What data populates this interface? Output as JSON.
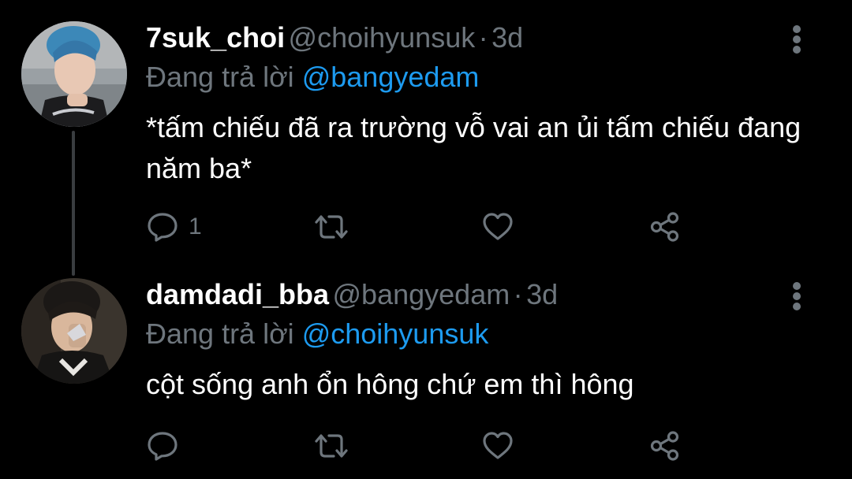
{
  "tweets": [
    {
      "display_name": "7suk_choi",
      "handle": "@choihyunsuk",
      "separator": "·",
      "time": "3d",
      "reply_prefix": "Đang trả lời",
      "reply_to": "@bangyedam",
      "text": "*tấm chiếu đã ra trường vỗ vai an ủi tấm chiếu đang năm ba*",
      "reply_count": "1",
      "avatar_icon": "profile-photo"
    },
    {
      "display_name": "damdadi_bba",
      "handle": "@bangyedam",
      "separator": "·",
      "time": "3d",
      "reply_prefix": "Đang trả lời",
      "reply_to": "@choihyunsuk",
      "text": "cột sống anh ổn hông chứ em thì hông",
      "reply_count": "",
      "avatar_icon": "profile-photo"
    }
  ],
  "icons": {
    "reply": "speech-bubble-icon",
    "retweet": "retweet-arrows-icon",
    "like": "heart-icon",
    "share": "share-nodes-icon",
    "more": "vertical-dots-icon"
  },
  "colors": {
    "background": "#000000",
    "primary_text": "#ffffff",
    "secondary_text": "#6e767d",
    "mention": "#1d9bf0",
    "thread_line": "#3a3d40"
  }
}
